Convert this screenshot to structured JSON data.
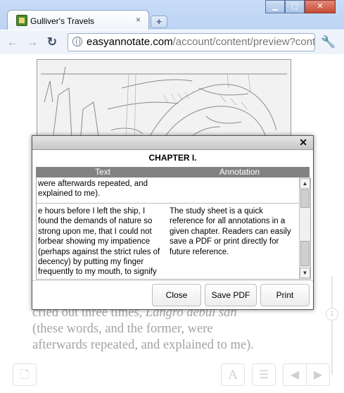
{
  "browser": {
    "tab_title": "Gulliver's Travels",
    "tab_close": "×",
    "new_tab": "+",
    "window_buttons": {
      "minimize": "▁",
      "maximize": "▢",
      "close": "✕"
    },
    "nav": {
      "back": "←",
      "forward": "→",
      "reload": "↻"
    },
    "url_host": "easyannotate.com",
    "url_path": "/account/content/preview?conten",
    "wrench": "🔧"
  },
  "page": {
    "background_text": {
      "line1_pre": "cried out three times, ",
      "line1_em": "Langro debul san",
      "line2": "(these words, and the former, were",
      "line3": "afterwards repeated, and explained to me)."
    },
    "side_knob": "1",
    "bottom_buttons": {
      "page_icon": "🗋",
      "font_size": "A",
      "list": "☰",
      "prev": "◀",
      "next": "▶"
    }
  },
  "modal": {
    "close": "✕",
    "chapter_title": "CHAPTER I.",
    "columns": {
      "text": "Text",
      "annotation": "Annotation"
    },
    "rows": [
      {
        "text": "were afterwards repeated, and explained to me).",
        "annotation": ""
      },
      {
        "text": "e hours before I left the ship, I found the demands of nature so strong upon me, that I could not forbear showing my impatience (perhaps against the strict rules of decency) by putting my finger frequently to my mouth, to signify",
        "annotation": "The study sheet is a quick reference for all annotations in a given chapter. Readers can easily save a PDF or print directly for future reference."
      }
    ],
    "scroll": {
      "up": "▲",
      "down": "▼"
    },
    "buttons": {
      "close": "Close",
      "save_pdf": "Save PDF",
      "print": "Print"
    }
  }
}
